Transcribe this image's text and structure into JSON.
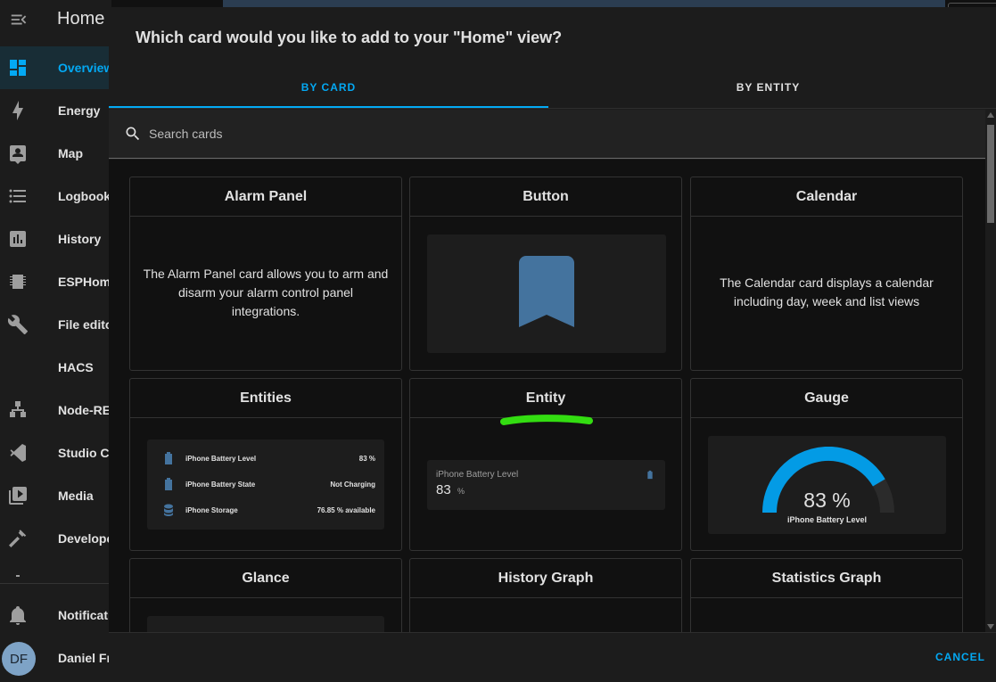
{
  "sidebar": {
    "title": "Home",
    "items": [
      {
        "label": "Overview",
        "icon": "dashboard-icon",
        "active": true
      },
      {
        "label": "Energy",
        "icon": "lightning-icon"
      },
      {
        "label": "Map",
        "icon": "map-account-icon"
      },
      {
        "label": "Logbook",
        "icon": "list-icon"
      },
      {
        "label": "History",
        "icon": "chart-box-icon"
      },
      {
        "label": "ESPHom",
        "icon": "chip-icon"
      },
      {
        "label": "File edito",
        "icon": "wrench-icon"
      },
      {
        "label": "HACS",
        "icon": ""
      },
      {
        "label": "Node-RE",
        "icon": "sitemap-icon"
      },
      {
        "label": "Studio Co",
        "icon": "vscode-icon"
      },
      {
        "label": "Media",
        "icon": "play-box-icon"
      },
      {
        "label": "Develope",
        "icon": "hammer-icon"
      }
    ],
    "notifications_label": "Notificati",
    "user_initials": "DF",
    "user_label": "Daniel Fr"
  },
  "dialog": {
    "title": "Which card would you like to add to your \"Home\" view?",
    "tabs": [
      {
        "label": "BY CARD",
        "active": true
      },
      {
        "label": "BY ENTITY",
        "active": false
      }
    ],
    "search_placeholder": "Search cards",
    "cancel_label": "CANCEL"
  },
  "cards": {
    "alarm_panel": {
      "title": "Alarm Panel",
      "description": "The Alarm Panel card allows you to arm and disarm your alarm control panel integrations."
    },
    "button": {
      "title": "Button"
    },
    "calendar": {
      "title": "Calendar",
      "description": "The Calendar card displays a calendar including day, week and list views"
    },
    "entities": {
      "title": "Entities",
      "rows": [
        {
          "name": "iPhone Battery Level",
          "value": "83 %",
          "icon": "battery-icon"
        },
        {
          "name": "iPhone Battery State",
          "value": "Not Charging",
          "icon": "battery-icon"
        },
        {
          "name": "iPhone Storage",
          "value": "76.85 % available",
          "icon": "database-icon"
        }
      ]
    },
    "entity": {
      "title": "Entity",
      "name": "iPhone Battery Level",
      "value": "83",
      "unit": "%"
    },
    "gauge": {
      "title": "Gauge",
      "value_text": "83 %",
      "name": "iPhone Battery Level",
      "value": 83
    },
    "glance": {
      "title": "Glance"
    },
    "history_graph": {
      "title": "History Graph"
    },
    "statistics_graph": {
      "title": "Statistics Graph"
    }
  },
  "colors": {
    "accent": "#03a9f4",
    "button_preview": "#44739e",
    "highlight_mark": "#33dd11"
  }
}
